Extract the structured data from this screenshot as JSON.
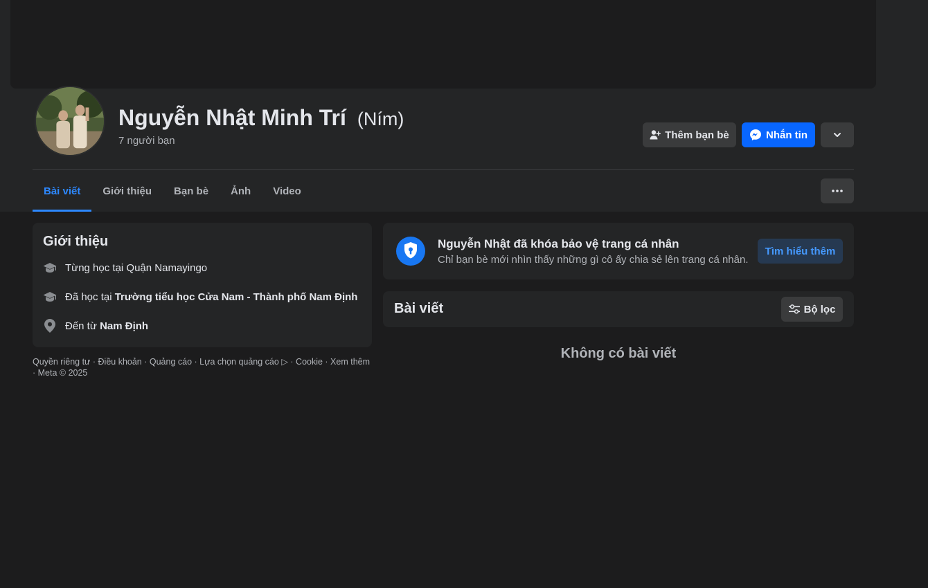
{
  "profile": {
    "name": "Nguyễn Nhật Minh Trí",
    "alternate_name": "(Ním)",
    "friends_count": "7 người bạn"
  },
  "actions": {
    "add_friend": "Thêm bạn bè",
    "message": "Nhắn tin"
  },
  "tabs": [
    {
      "label": "Bài viết",
      "active": true
    },
    {
      "label": "Giới thiệu",
      "active": false
    },
    {
      "label": "Bạn bè",
      "active": false
    },
    {
      "label": "Ảnh",
      "active": false
    },
    {
      "label": "Video",
      "active": false
    }
  ],
  "intro": {
    "title": "Giới thiệu",
    "items": [
      {
        "icon": "graduation-cap-icon",
        "prefix": "Từng học tại Quận Namayingo",
        "bold": ""
      },
      {
        "icon": "graduation-cap-icon",
        "prefix": "Đã học tại ",
        "bold": "Trường tiểu học Cửa Nam - Thành phố Nam Định"
      },
      {
        "icon": "location-pin-icon",
        "prefix": "Đến từ ",
        "bold": "Nam Định"
      }
    ]
  },
  "footer": "Quyền riêng tư · Điều khoản · Quảng cáo · Lựa chọn quảng cáo ▷ · Cookie · Xem thêm · Meta © 2025",
  "locked_notice": {
    "title": "Nguyễn Nhật đã khóa bảo vệ trang cá nhân",
    "subtitle": "Chỉ bạn bè mới nhìn thấy những gì cô ấy chia sẻ lên trang cá nhân.",
    "button": "Tìm hiểu thêm"
  },
  "posts": {
    "title": "Bài viết",
    "filter_label": "Bộ lọc",
    "empty_text": "Không có bài viết"
  },
  "colors": {
    "accent": "#2d88ff",
    "messenger_blue": "#0866ff",
    "background": "#1c1c1d",
    "card": "#242526"
  }
}
